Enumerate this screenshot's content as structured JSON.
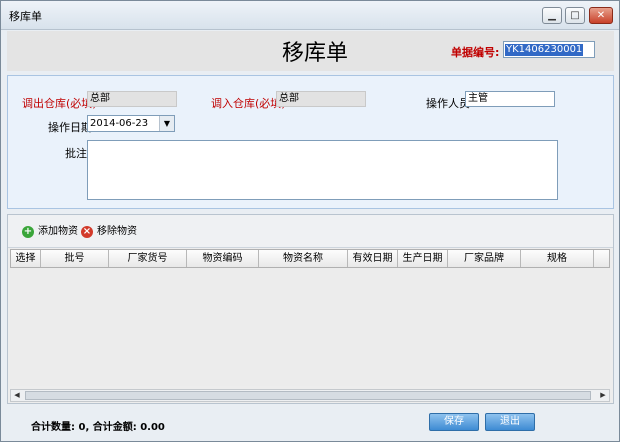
{
  "window": {
    "title": "移库单",
    "buttons": [
      "minimize",
      "maximize",
      "close"
    ]
  },
  "header": {
    "title": "移库单",
    "doc_no_label": "单据编号:",
    "doc_no_value": "YK1406230001"
  },
  "form": {
    "out_wh_label": "调出仓库(必填)",
    "out_wh_value": "总部",
    "in_wh_label": "调入仓库(必填)",
    "in_wh_value": "总部",
    "operator_label": "操作人员",
    "operator_value": "主管",
    "date_label": "操作日期",
    "date_value": "2014-06-23",
    "note_label": "批注",
    "note_value": ""
  },
  "toolbar": {
    "add_label": "添加物资",
    "remove_label": "移除物资"
  },
  "table": {
    "columns": [
      "选择",
      "批号",
      "厂家货号",
      "物资编码",
      "物资名称",
      "有效日期",
      "生产日期",
      "厂家品牌",
      "规格"
    ],
    "rows": []
  },
  "footer": {
    "summary": "合计数量: 0, 合计金额: 0.00",
    "save_label": "保存",
    "exit_label": "退出"
  },
  "colors": {
    "required_label": "#c00000",
    "button_blue": "#3e8bd3",
    "form_bg": "#eaf2fb"
  },
  "icons": {
    "add": "plus-circle-icon",
    "remove": "x-circle-icon"
  }
}
